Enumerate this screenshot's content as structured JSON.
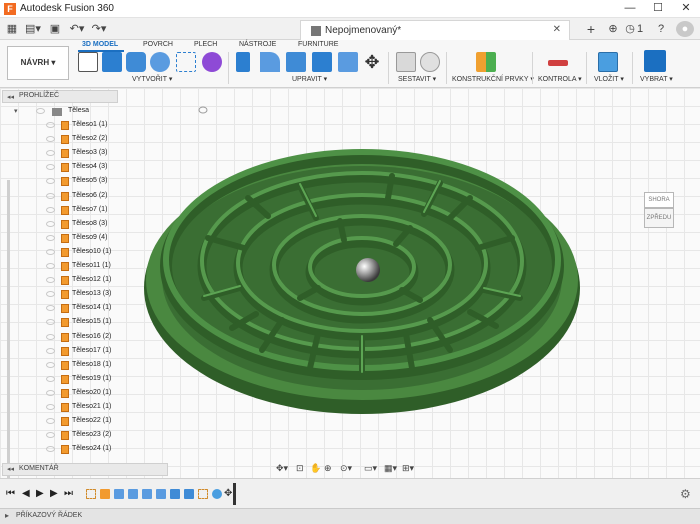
{
  "app": {
    "title": "Autodesk Fusion 360",
    "logo": "F"
  },
  "window": {
    "minimize": "—",
    "maximize": "☐",
    "close": "✕"
  },
  "tabbar": {
    "document_title": "Nepojmenovaný*",
    "close": "✕",
    "add": "+",
    "count": "1"
  },
  "ribbon": {
    "workspace": "NÁVRH ▾",
    "tabs": [
      "3D MODEL",
      "POVRCH",
      "PLECH",
      "NÁSTROJE",
      "FURNITURE"
    ],
    "groups": [
      "VYTVOŘIT ▾",
      "UPRAVIT ▾",
      "SESTAVIT ▾",
      "KONSTRUKČNÍ PRVKY ▾",
      "KONTROLA ▾",
      "VLOŽIT ▾",
      "VYBRAT ▾"
    ]
  },
  "browser": {
    "header": "PROHLÍŽEČ",
    "folder": "Tělesa",
    "items": [
      "Těleso1 (1)",
      "Těleso2 (2)",
      "Těleso3 (3)",
      "Těleso4 (3)",
      "Těleso5 (3)",
      "Těleso6 (2)",
      "Těleso7 (1)",
      "Těleso8 (3)",
      "Těleso9 (4)",
      "Těleso10 (1)",
      "Těleso11 (1)",
      "Těleso12 (1)",
      "Těleso13 (3)",
      "Těleso14 (1)",
      "Těleso15 (1)",
      "Těleso16 (2)",
      "Těleso17 (1)",
      "Těleso18 (1)",
      "Těleso19 (1)",
      "Těleso20 (1)",
      "Těleso21 (1)",
      "Těleso22 (1)",
      "Těleso23 (2)",
      "Těleso24 (1)"
    ]
  },
  "comments": {
    "label": "KOMENTÁŘ"
  },
  "viewcube": {
    "top": "SHORA",
    "front": "ZPŘEDU"
  },
  "statusbar": {
    "label": "PŘÍKAZOVÝ ŘÁDEK"
  },
  "colors": {
    "maze_green": "#3f7a37",
    "accent_blue": "#1b6fc1",
    "body_orange": "#f29a2e"
  }
}
